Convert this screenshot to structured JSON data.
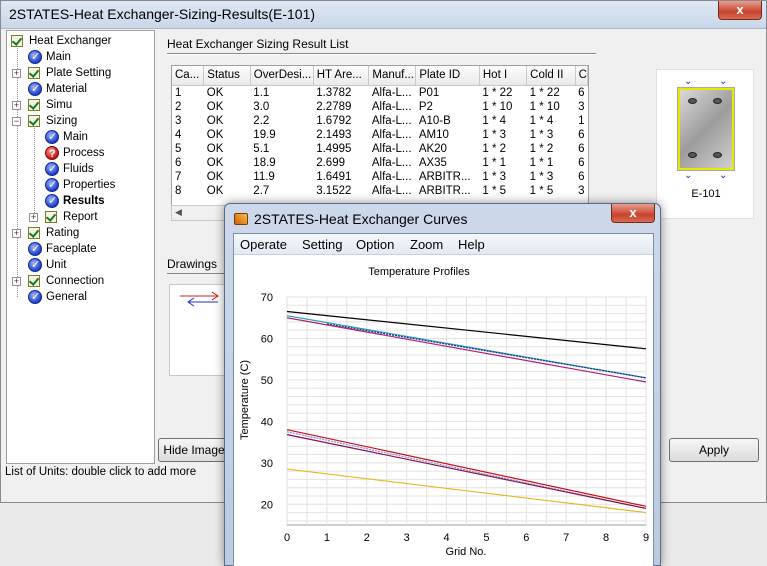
{
  "main_window": {
    "title": "2STATES-Heat Exchanger-Sizing-Results(E-101)",
    "close_label": "x"
  },
  "tree": {
    "items": [
      {
        "label": "Heat Exchanger",
        "icon": "check-icon",
        "expander": ""
      },
      {
        "label": "Main",
        "icon": "blue-check-icon",
        "expander": ""
      },
      {
        "label": "Plate Setting",
        "icon": "check-icon",
        "expander": "+"
      },
      {
        "label": "Material",
        "icon": "blue-check-icon",
        "expander": ""
      },
      {
        "label": "Simu",
        "icon": "check-icon",
        "expander": "+"
      },
      {
        "label": "Sizing",
        "icon": "check-icon",
        "expander": "−"
      },
      {
        "label": "Main",
        "icon": "blue-check-icon",
        "expander": ""
      },
      {
        "label": "Process",
        "icon": "red-question-icon",
        "expander": ""
      },
      {
        "label": "Fluids",
        "icon": "blue-check-icon",
        "expander": ""
      },
      {
        "label": "Properties",
        "icon": "blue-check-icon",
        "expander": ""
      },
      {
        "label": "Results",
        "icon": "blue-check-icon",
        "expander": ""
      },
      {
        "label": "Report",
        "icon": "check-icon",
        "expander": "+"
      },
      {
        "label": "Rating",
        "icon": "check-icon",
        "expander": "+"
      },
      {
        "label": "Faceplate",
        "icon": "blue-check-icon",
        "expander": ""
      },
      {
        "label": "Unit",
        "icon": "blue-check-icon",
        "expander": ""
      },
      {
        "label": "Connection",
        "icon": "check-icon",
        "expander": "+"
      },
      {
        "label": "General",
        "icon": "blue-check-icon",
        "expander": ""
      }
    ]
  },
  "results": {
    "section_title": "Heat Exchanger Sizing Result List",
    "columns": [
      "Ca...",
      "Status",
      "OverDesi...",
      "HT Are...",
      "Manuf...",
      "Plate ID",
      "Hot I",
      "Cold II",
      "C"
    ],
    "rows": [
      [
        "1",
        "OK",
        "1.1",
        "1.3782",
        "Alfa-L...",
        "P01",
        "1 * 22",
        "1 * 22",
        "6"
      ],
      [
        "2",
        "OK",
        "3.0",
        "2.2789",
        "Alfa-L...",
        "P2",
        "1 * 10",
        "1 * 10",
        "3"
      ],
      [
        "3",
        "OK",
        "2.2",
        "1.6792",
        "Alfa-L...",
        "A10-B",
        "1 * 4",
        "1 * 4",
        "1"
      ],
      [
        "4",
        "OK",
        "19.9",
        "2.1493",
        "Alfa-L...",
        "AM10",
        "1 * 3",
        "1 * 3",
        "6"
      ],
      [
        "5",
        "OK",
        "5.1",
        "1.4995",
        "Alfa-L...",
        "AK20",
        "1 * 2",
        "1 * 2",
        "6"
      ],
      [
        "6",
        "OK",
        "18.9",
        "2.699",
        "Alfa-L...",
        "AX35",
        "1 * 1",
        "1 * 1",
        "6"
      ],
      [
        "7",
        "OK",
        "11.9",
        "1.6491",
        "Alfa-L...",
        "ARBITR...",
        "1 * 3",
        "1 * 3",
        "6"
      ],
      [
        "8",
        "OK",
        "2.7",
        "3.1522",
        "Alfa-L...",
        "ARBITR...",
        "1 * 5",
        "1 * 5",
        "3"
      ]
    ]
  },
  "image_panel": {
    "label": "E-101"
  },
  "drawings": {
    "tab_label": "Drawings"
  },
  "buttons": {
    "hide_image": "Hide Image",
    "apply": "Apply"
  },
  "status_bar": {
    "text": "List of Units: double click to add more"
  },
  "curves_window": {
    "title": "2STATES-Heat Exchanger Curves",
    "close_label": "x",
    "menu": [
      "Operate",
      "Setting",
      "Option",
      "Zoom",
      "Help"
    ]
  },
  "chart_data": {
    "type": "line",
    "title": "Temperature Profiles",
    "xlabel": "Grid No.",
    "ylabel": "Temperature (C)",
    "xlim": [
      0,
      9
    ],
    "ylim": [
      15,
      70
    ],
    "xticks": [
      0,
      1,
      2,
      3,
      4,
      5,
      6,
      7,
      8,
      9
    ],
    "yticks": [
      20,
      30,
      40,
      50,
      60,
      70
    ],
    "grid": true,
    "series": [
      {
        "color": "#000000",
        "x": [
          0,
          9
        ],
        "y": [
          66.5,
          57.5
        ],
        "dashed": false
      },
      {
        "color": "#2a9fb0",
        "x": [
          0,
          9
        ],
        "y": [
          65.5,
          50.5
        ],
        "dashed": false
      },
      {
        "color": "#1a2aa0",
        "x": [
          1,
          9
        ],
        "y": [
          63.5,
          50.5
        ],
        "dashed": true
      },
      {
        "color": "#b02070",
        "x": [
          0,
          9
        ],
        "y": [
          65.0,
          49.5
        ],
        "dashed": false
      },
      {
        "color": "#cc1010",
        "x": [
          0,
          9
        ],
        "y": [
          38.0,
          19.5
        ],
        "dashed": false
      },
      {
        "color": "#8090e0",
        "x": [
          0,
          9
        ],
        "y": [
          37.5,
          19.0
        ],
        "dashed": true
      },
      {
        "color": "#8a1050",
        "x": [
          0,
          9
        ],
        "y": [
          36.8,
          19.0
        ],
        "dashed": false
      },
      {
        "color": "#e8b820",
        "x": [
          0,
          9
        ],
        "y": [
          28.5,
          18.0
        ],
        "dashed": false
      }
    ]
  }
}
